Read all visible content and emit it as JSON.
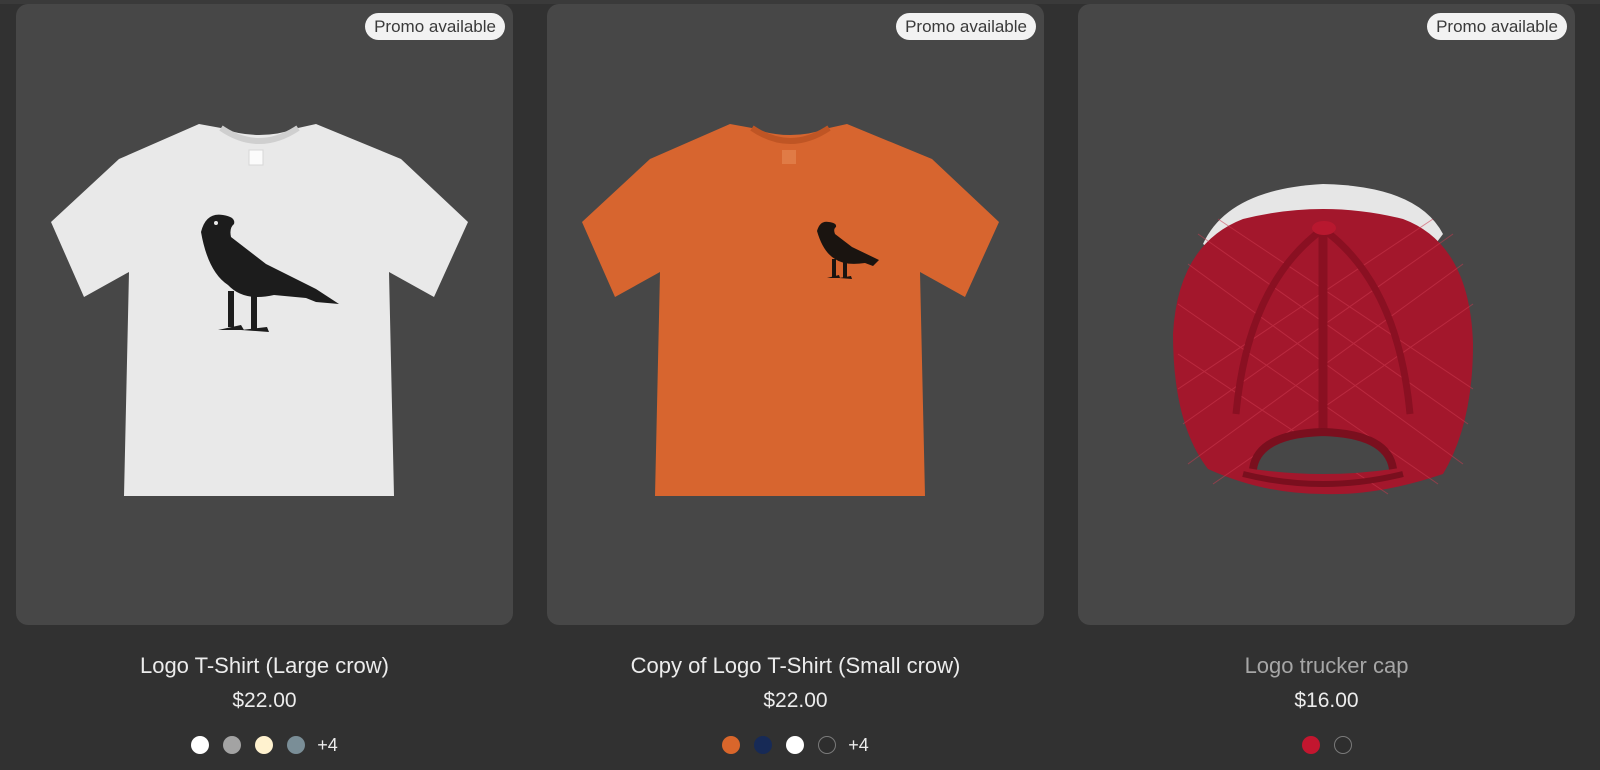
{
  "products": [
    {
      "badge": "Promo available",
      "title": "Logo T-Shirt (Large crow)",
      "price": "$22.00",
      "image": "white-tshirt-large-crow",
      "swatches": [
        "#ffffff",
        "#a3a3a3",
        "#fff2cf",
        "#7a8e97"
      ],
      "more_label": "+4"
    },
    {
      "badge": "Promo available",
      "title": "Copy of Logo T-Shirt (Small crow)",
      "price": "$22.00",
      "image": "orange-tshirt-small-crow",
      "swatches": [
        "#d9662b",
        "#172a56",
        "#ffffff",
        "#2e2e2e"
      ],
      "more_label": "+4"
    },
    {
      "badge": "Promo available",
      "title": "Logo trucker cap",
      "price": "$16.00",
      "image": "red-white-trucker-cap",
      "swatches": [
        "#c3162f",
        "#2e2e2e"
      ],
      "more_label": ""
    }
  ]
}
